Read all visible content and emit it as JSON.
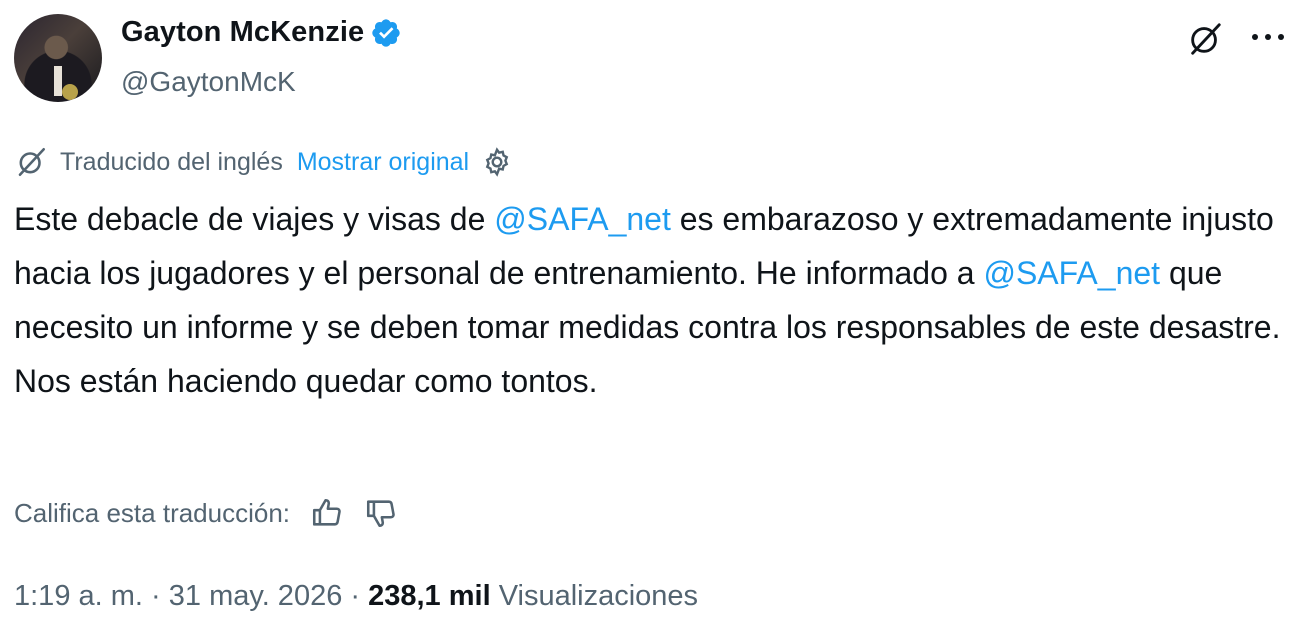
{
  "author": {
    "display_name": "Gayton McKenzie",
    "handle": "@GaytonMcK",
    "verified": true
  },
  "translation_bar": {
    "label": "Traducido del inglés",
    "show_original": "Mostrar original",
    "icon": "translate-icon",
    "settings_icon": "gear-icon"
  },
  "tweet": {
    "p1": "Este debacle de viajes y visas de ",
    "mention1": "@SAFA_net",
    "p2": " es embarazoso y extremadamente injusto hacia los jugadores y el personal de entrenamiento. He informado a ",
    "mention2": "@SAFA_net",
    "p3": " que necesito un informe y se deben tomar medidas contra los responsables de este desastre. Nos están haciendo quedar como tontos."
  },
  "rating": {
    "label": "Califica esta traducción:",
    "up_icon": "thumbs-up-icon",
    "down_icon": "thumbs-down-icon"
  },
  "meta": {
    "time": "1:19 a. m.",
    "sep1": " · ",
    "date": "31 may. 2026",
    "sep2": " · ",
    "views_count": "238,1 mil",
    "views_label": " Visualizaciones"
  },
  "colors": {
    "accent": "#1d9bf0",
    "secondary_text": "#536471",
    "primary_text": "#0f1419"
  }
}
